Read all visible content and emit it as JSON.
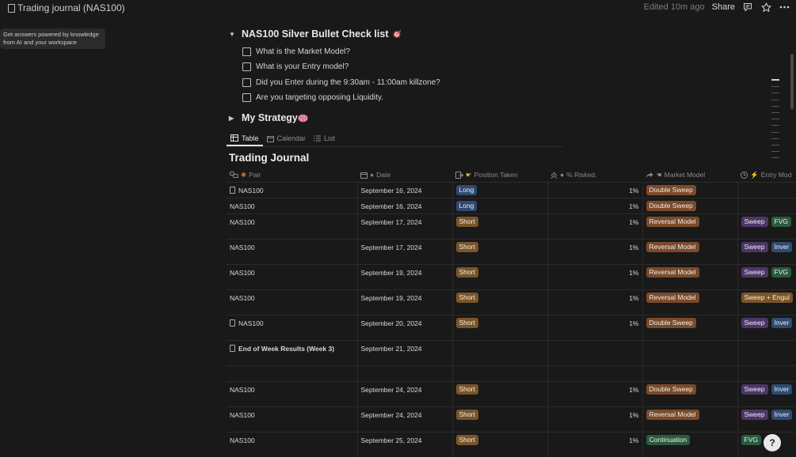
{
  "topbar": {
    "title": "Trading journal (NAS100)",
    "edited": "Edited 10m ago",
    "share": "Share"
  },
  "tooltip": {
    "line1": "Get answers powered by knowledge",
    "line2": "from AI and your workspace"
  },
  "checklist": {
    "title": "NAS100 Silver Bullet Check list",
    "items": [
      "What is the Market Model?",
      "What is your Entry model?",
      "Did you Enter during the 9:30am - 11:00am killzone?",
      "Are you targeting opposing Liquidity."
    ]
  },
  "strategy": {
    "title": "My Strategy"
  },
  "tabs": [
    "Table",
    "Calendar",
    "List"
  ],
  "heading": "Trading Journal",
  "columns": [
    "Pair",
    "Date",
    "Position Taken",
    "% Risked.",
    "Market Model",
    "Entry Mod"
  ],
  "rows": [
    {
      "pair": "NAS100",
      "doc": true,
      "date": "September 16, 2024",
      "pos": "Long",
      "risk": "1%",
      "model": "Double Sweep",
      "entry": [],
      "tall": false
    },
    {
      "pair": "NAS100",
      "doc": false,
      "date": "September 16, 2024",
      "pos": "Long",
      "risk": "1%",
      "model": "Double Sweep",
      "entry": [],
      "tall": false
    },
    {
      "pair": "NAS100",
      "doc": false,
      "date": "September 17, 2024",
      "pos": "Short",
      "risk": "1%",
      "model": "Reversal Model",
      "entry": [
        "Sweep",
        "FVG"
      ],
      "tall": true
    },
    {
      "pair": "NAS100",
      "doc": false,
      "date": "September 17, 2024",
      "pos": "Short",
      "risk": "1%",
      "model": "Reversal Model",
      "entry": [
        "Sweep",
        "Inver"
      ],
      "tall": true
    },
    {
      "pair": "NAS100",
      "doc": false,
      "date": "September 19, 2024",
      "pos": "Short",
      "risk": "1%",
      "model": "Reversal Model",
      "entry": [
        "Sweep",
        "FVG"
      ],
      "tall": true
    },
    {
      "pair": "NAS100",
      "doc": false,
      "date": "September 19, 2024",
      "pos": "Short",
      "risk": "1%",
      "model": "Reversal Model",
      "entry": [
        "Sweep + Engul"
      ],
      "tall": true
    },
    {
      "pair": "NAS100",
      "doc": true,
      "date": "September 20, 2024",
      "pos": "Short",
      "risk": "1%",
      "model": "Double Sweep",
      "entry": [
        "Sweep",
        "Inver"
      ],
      "tall": true
    },
    {
      "pair": "End of Week Results (Week 3)",
      "doc": true,
      "bold": true,
      "date": "September 21, 2024",
      "pos": "",
      "risk": "",
      "model": "",
      "entry": [],
      "tall": true
    },
    {
      "pair": "",
      "doc": false,
      "date": "",
      "pos": "",
      "risk": "",
      "model": "",
      "entry": [],
      "tall": false
    },
    {
      "pair": "NAS100",
      "doc": false,
      "date": "September 24, 2024",
      "pos": "Short",
      "risk": "1%",
      "model": "Double Sweep",
      "entry": [
        "Sweep",
        "Inver"
      ],
      "tall": true
    },
    {
      "pair": "NAS100",
      "doc": false,
      "date": "September 24, 2024",
      "pos": "Short",
      "risk": "1%",
      "model": "Reversal Model",
      "entry": [
        "Sweep",
        "Inver"
      ],
      "tall": true
    },
    {
      "pair": "NAS100",
      "doc": false,
      "date": "September 25, 2024",
      "pos": "Short",
      "risk": "1%",
      "model": "Continuation",
      "entry": [
        "FVG"
      ],
      "tall": true
    }
  ],
  "help": "?"
}
